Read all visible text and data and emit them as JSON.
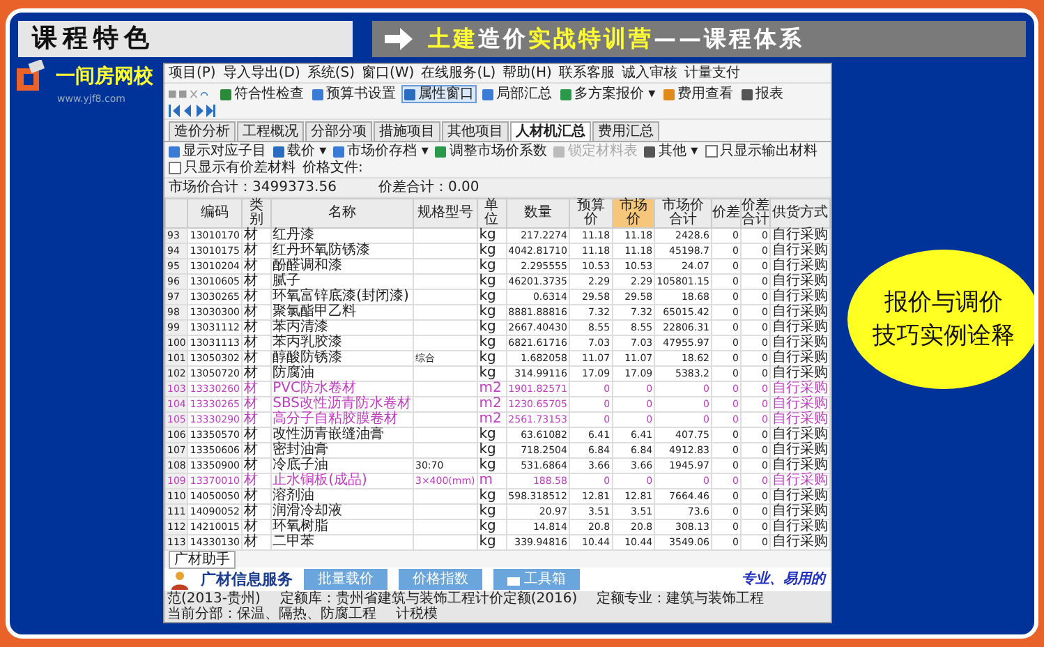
{
  "banner": {
    "section_title": "课程特色",
    "headline": [
      {
        "text": "土建",
        "highlight": true
      },
      {
        "text": "造价",
        "highlight": false
      },
      {
        "text": "实战特训营",
        "highlight": true
      },
      {
        "text": "——课程体系",
        "highlight": false
      }
    ]
  },
  "logo": {
    "name": "一间房网校",
    "url": "www.yjf8.com"
  },
  "callout": {
    "lines": [
      "报价与调价",
      "技巧实例诠释"
    ]
  },
  "app": {
    "menu": [
      "项目(P)",
      "导入导出(D)",
      "系统(S)",
      "窗口(W)",
      "在线服务(L)",
      "帮助(H)",
      "联系客服",
      "诚入审核",
      "计量支付"
    ],
    "toolbar": [
      {
        "label": "符合性检查",
        "selected": false
      },
      {
        "label": "预算书设置",
        "selected": false
      },
      {
        "label": "属性窗口",
        "selected": true
      },
      {
        "label": "局部汇总",
        "selected": false
      },
      {
        "label": "多方案报价 ▾",
        "selected": false
      },
      {
        "label": "费用查看",
        "selected": false
      },
      {
        "label": "报表",
        "selected": false
      }
    ],
    "tabs": [
      {
        "label": "造价分析",
        "selected": false
      },
      {
        "label": "工程概况",
        "selected": false
      },
      {
        "label": "分部分项",
        "selected": false
      },
      {
        "label": "措施项目",
        "selected": false
      },
      {
        "label": "其他项目",
        "selected": false
      },
      {
        "label": "人材机汇总",
        "selected": true
      },
      {
        "label": "费用汇总",
        "selected": false
      }
    ],
    "subtoolbar": [
      {
        "kind": "button",
        "label": "显示对应子目",
        "disabled": false
      },
      {
        "kind": "button",
        "label": "载价 ▾",
        "disabled": false
      },
      {
        "kind": "button",
        "label": "市场价存档 ▾",
        "disabled": false
      },
      {
        "kind": "button",
        "label": "调整市场价系数",
        "disabled": false
      },
      {
        "kind": "button",
        "label": "锁定材料表",
        "disabled": true
      },
      {
        "kind": "button",
        "label": "其他 ▾",
        "disabled": false
      },
      {
        "kind": "checkbox",
        "label": "只显示输出材料",
        "checked": false
      },
      {
        "kind": "checkbox",
        "label": "只显示有价差材料",
        "checked": false
      },
      {
        "kind": "label",
        "label": "价格文件:"
      }
    ],
    "summary": [
      "市场价合计：3499373.56",
      "价差合计：0.00"
    ],
    "table": {
      "columns": [
        {
          "label": "编码",
          "selected": false
        },
        {
          "label": "类别",
          "selected": false
        },
        {
          "label": "名称",
          "selected": false
        },
        {
          "label": "规格型号",
          "selected": false
        },
        {
          "label": "单位",
          "selected": false
        },
        {
          "label": "数量",
          "selected": false
        },
        {
          "label": "预算价",
          "selected": false
        },
        {
          "label": "市场价",
          "selected": true
        },
        {
          "label": "市场价合计",
          "selected": false
        },
        {
          "label": "价差",
          "selected": false
        },
        {
          "label": "价差合计",
          "selected": false
        },
        {
          "label": "供货方式",
          "selected": false
        }
      ],
      "rows": [
        {
          "number": "93",
          "highlighted": false,
          "cells": [
            "13010170",
            "材",
            "红丹漆",
            "",
            "kg",
            "217.2274",
            "11.18",
            "11.18",
            "2428.6",
            "0",
            "0",
            "自行采购"
          ]
        },
        {
          "number": "94",
          "highlighted": false,
          "cells": [
            "13010175",
            "材",
            "红丹环氧防锈漆",
            "",
            "kg",
            "4042.81710",
            "11.18",
            "11.18",
            "45198.7",
            "0",
            "0",
            "自行采购"
          ]
        },
        {
          "number": "95",
          "highlighted": false,
          "cells": [
            "13010204",
            "材",
            "酚醛调和漆",
            "",
            "kg",
            "2.295555",
            "10.53",
            "10.53",
            "24.07",
            "0",
            "0",
            "自行采购"
          ]
        },
        {
          "number": "96",
          "highlighted": false,
          "cells": [
            "13010605",
            "材",
            "腻子",
            "",
            "kg",
            "46201.3735",
            "2.29",
            "2.29",
            "105801.15",
            "0",
            "0",
            "自行采购"
          ]
        },
        {
          "number": "97",
          "highlighted": false,
          "cells": [
            "13030265",
            "材",
            "环氧富锌底漆(封闭漆)",
            "",
            "kg",
            "0.6314",
            "29.58",
            "29.58",
            "18.68",
            "0",
            "0",
            "自行采购"
          ]
        },
        {
          "number": "98",
          "highlighted": false,
          "cells": [
            "13030300",
            "材",
            "聚氯酯甲乙料",
            "",
            "kg",
            "8881.88816",
            "7.32",
            "7.32",
            "65015.42",
            "0",
            "0",
            "自行采购"
          ]
        },
        {
          "number": "99",
          "highlighted": false,
          "cells": [
            "13031112",
            "材",
            "苯丙清漆",
            "",
            "kg",
            "2667.40430",
            "8.55",
            "8.55",
            "22806.31",
            "0",
            "0",
            "自行采购"
          ]
        },
        {
          "number": "100",
          "highlighted": false,
          "cells": [
            "13031113",
            "材",
            "苯丙乳胶漆",
            "",
            "kg",
            "6821.61716",
            "7.03",
            "7.03",
            "47955.97",
            "0",
            "0",
            "自行采购"
          ]
        },
        {
          "number": "101",
          "highlighted": false,
          "cells": [
            "13050302",
            "材",
            "醇酸防锈漆",
            "综合",
            "kg",
            "1.682058",
            "11.07",
            "11.07",
            "18.62",
            "0",
            "0",
            "自行采购"
          ]
        },
        {
          "number": "102",
          "highlighted": false,
          "cells": [
            "13050720",
            "材",
            "防腐油",
            "",
            "kg",
            "314.99116",
            "17.09",
            "17.09",
            "5383.2",
            "0",
            "0",
            "自行采购"
          ]
        },
        {
          "number": "103",
          "highlighted": true,
          "cells": [
            "13330260",
            "材",
            "PVC防水卷材",
            "",
            "m2",
            "1901.82571",
            "0",
            "0",
            "0",
            "0",
            "0",
            "自行采购"
          ]
        },
        {
          "number": "104",
          "highlighted": true,
          "cells": [
            "13330265",
            "材",
            "SBS改性沥青防水卷材",
            "",
            "m2",
            "1230.65705",
            "0",
            "0",
            "0",
            "0",
            "0",
            "自行采购"
          ]
        },
        {
          "number": "105",
          "highlighted": true,
          "cells": [
            "13330290",
            "材",
            "高分子自粘胶膜卷材",
            "",
            "m2",
            "2561.73153",
            "0",
            "0",
            "0",
            "0",
            "0",
            "自行采购"
          ]
        },
        {
          "number": "106",
          "highlighted": false,
          "cells": [
            "13350570",
            "材",
            "改性沥青嵌缝油膏",
            "",
            "kg",
            "63.61082",
            "6.41",
            "6.41",
            "407.75",
            "0",
            "0",
            "自行采购"
          ]
        },
        {
          "number": "107",
          "highlighted": false,
          "cells": [
            "13350606",
            "材",
            "密封油膏",
            "",
            "kg",
            "718.2504",
            "6.84",
            "6.84",
            "4912.83",
            "0",
            "0",
            "自行采购"
          ]
        },
        {
          "number": "108",
          "highlighted": false,
          "cells": [
            "13350900",
            "材",
            "冷底子油",
            "30:70",
            "kg",
            "531.6864",
            "3.66",
            "3.66",
            "1945.97",
            "0",
            "0",
            "自行采购"
          ]
        },
        {
          "number": "109",
          "highlighted": true,
          "cells": [
            "13370010",
            "材",
            "止水铜板(成品)",
            "3×400(mm)",
            "m",
            "188.58",
            "0",
            "0",
            "0",
            "0",
            "0",
            "自行采购"
          ]
        },
        {
          "number": "110",
          "highlighted": false,
          "cells": [
            "14050050",
            "材",
            "溶剂油",
            "",
            "kg",
            "598.318512",
            "12.81",
            "12.81",
            "7664.46",
            "0",
            "0",
            "自行采购"
          ]
        },
        {
          "number": "111",
          "highlighted": false,
          "cells": [
            "14090052",
            "材",
            "润滑冷却液",
            "",
            "kg",
            "20.97",
            "3.51",
            "3.51",
            "73.6",
            "0",
            "0",
            "自行采购"
          ]
        },
        {
          "number": "112",
          "highlighted": false,
          "cells": [
            "14210015",
            "材",
            "环氧树脂",
            "",
            "kg",
            "14.814",
            "20.8",
            "20.8",
            "308.13",
            "0",
            "0",
            "自行采购"
          ]
        },
        {
          "number": "113",
          "highlighted": false,
          "cells": [
            "14330130",
            "材",
            "二甲苯",
            "",
            "kg",
            "339.94816",
            "10.44",
            "10.44",
            "3549.06",
            "0",
            "0",
            "自行采购"
          ]
        }
      ]
    },
    "helper_tab": "广材助手",
    "info_bar": {
      "title": "广材信息服务",
      "buttons": [
        "批量载价",
        "价格指数",
        "工具箱"
      ],
      "slogan": "专业、易用的"
    },
    "status_bar": [
      "范(2013-贵州)",
      "定额库：贵州省建筑与装饰工程计价定额(2016)",
      "定额专业：建筑与装饰工程",
      "当前分部：保温、隔热、防腐工程",
      "计税模"
    ]
  }
}
